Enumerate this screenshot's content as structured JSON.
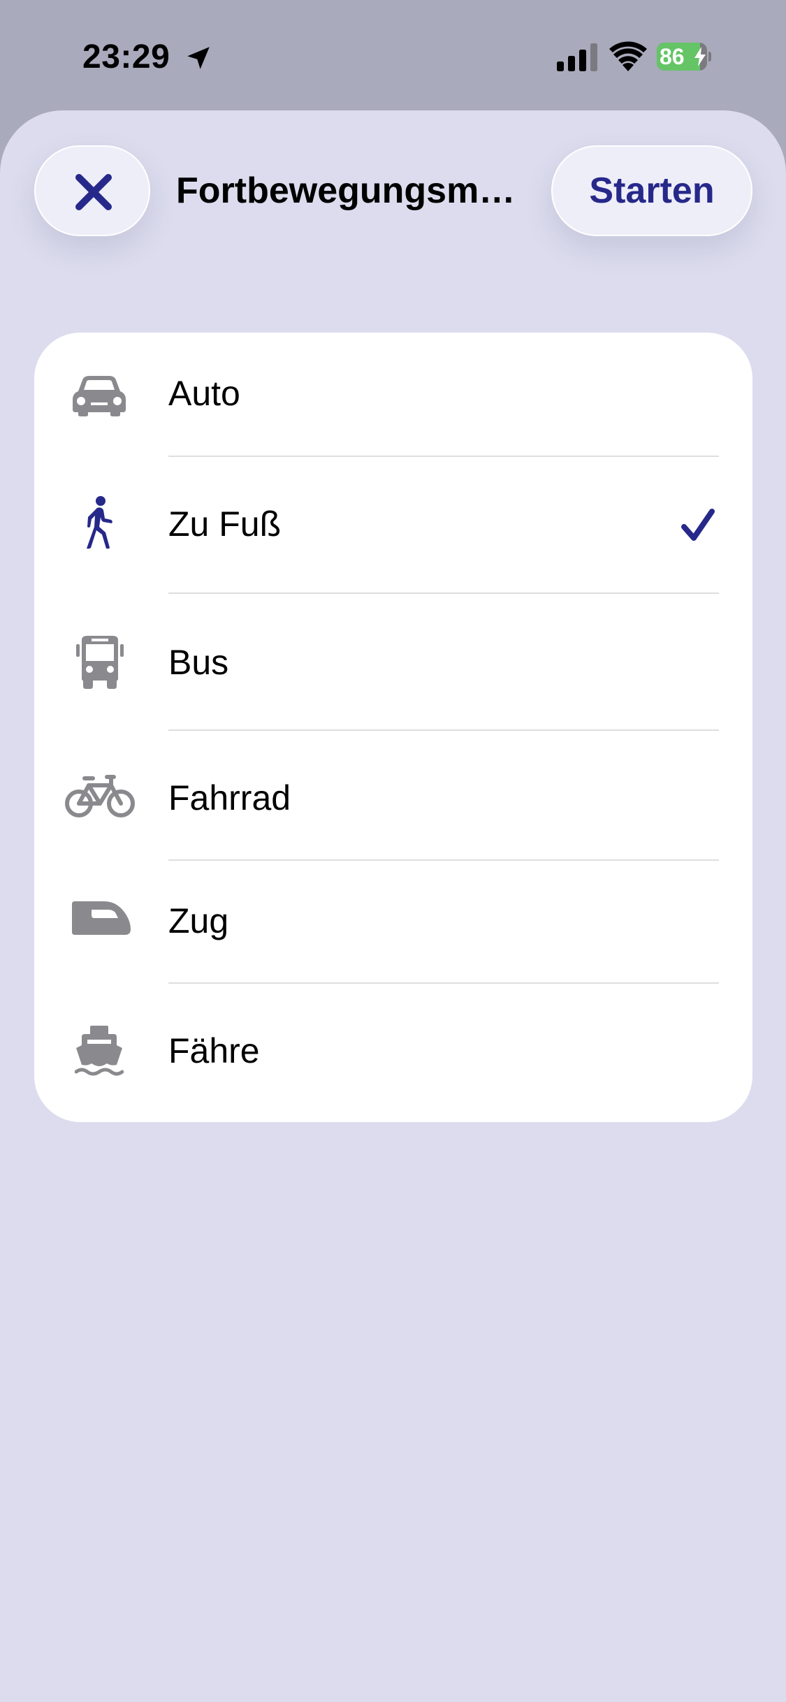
{
  "status_bar": {
    "time": "23:29",
    "battery_percent": "86",
    "battery_level": 0.86
  },
  "header": {
    "close_label": "",
    "title": "Fortbewegungsm…",
    "start_label": "Starten"
  },
  "colors": {
    "accent": "#26288a",
    "icon_gray": "#8a8a8e",
    "sheet_bg": "#dcdcee",
    "battery_green": "#65c466"
  },
  "options": [
    {
      "label": "Auto",
      "icon": "car-icon",
      "selected": false
    },
    {
      "label": "Zu Fuß",
      "icon": "walking-icon",
      "selected": true
    },
    {
      "label": "Bus",
      "icon": "bus-icon",
      "selected": false
    },
    {
      "label": "Fahrrad",
      "icon": "bicycle-icon",
      "selected": false
    },
    {
      "label": "Zug",
      "icon": "train-icon",
      "selected": false
    },
    {
      "label": "Fähre",
      "icon": "ferry-icon",
      "selected": false
    }
  ]
}
